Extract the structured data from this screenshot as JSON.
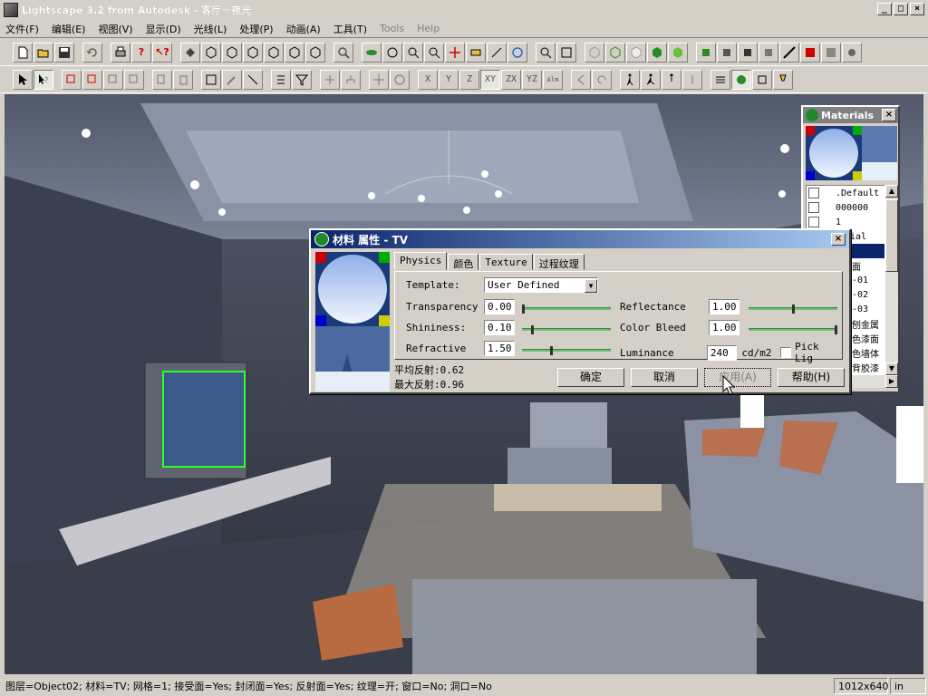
{
  "window": {
    "title": "Lightscape 3.2 from Autodesk - 客厅一夜光",
    "controls": {
      "minimize": "_",
      "maximize": "□",
      "close": "×"
    }
  },
  "menu": [
    {
      "label": "文件(F)",
      "dim": false
    },
    {
      "label": "编辑(E)",
      "dim": false
    },
    {
      "label": "视图(V)",
      "dim": false
    },
    {
      "label": "显示(D)",
      "dim": false
    },
    {
      "label": "光线(L)",
      "dim": false
    },
    {
      "label": "处理(P)",
      "dim": false
    },
    {
      "label": "动画(A)",
      "dim": false
    },
    {
      "label": "工具(T)",
      "dim": false
    },
    {
      "label": "Tools",
      "dim": true
    },
    {
      "label": "Help",
      "dim": true
    }
  ],
  "toolbar2_axes": [
    "X",
    "Y",
    "Z",
    "XY",
    "ZX",
    "YZ",
    "Alm"
  ],
  "dialog": {
    "title": "材料 属性 - TV",
    "close": "×",
    "tabs": [
      "Physics",
      "颜色",
      "Texture",
      "过程纹理"
    ],
    "active_tab": 0,
    "template_label": "Template:",
    "template_value": "User Defined",
    "fields": {
      "transparency": {
        "label": "Transparency",
        "value": "0.00",
        "slider": 0.0
      },
      "shininess": {
        "label": "Shininess:",
        "value": "0.10",
        "slider": 0.1
      },
      "refractive": {
        "label": "Refractive",
        "value": "1.50",
        "slider": 0.33
      },
      "reflectance": {
        "label": "Reflectance",
        "value": "1.00",
        "slider": 0.5
      },
      "color_bleed": {
        "label": "Color Bleed",
        "value": "1.00",
        "slider": 1.0
      },
      "luminance": {
        "label": "Luminance",
        "value": "240",
        "unit": "cd/m2"
      }
    },
    "pick_light_label": "Pick Lig",
    "avg_reflect": "平均反射:0.62",
    "max_reflect": "最大反射:0.96",
    "buttons": {
      "ok": "确定",
      "cancel": "取消",
      "apply": "应用(A)",
      "help": "帮助(H)"
    }
  },
  "materials": {
    "title": "Materials",
    "close": "×",
    "items": [
      ".Default",
      "000000",
      "1",
      "erial",
      "",
      "面",
      "-01",
      "-02",
      "-03",
      "刨金属",
      "色漆面",
      "色墙体",
      "背胶漆"
    ]
  },
  "status": {
    "text": "图层=Object02; 材料=TV; 网格=1; 接受面=Yes; 封闭面=Yes; 反射面=Yes; 纹理=开; 窗口=No; 洞口=No",
    "resolution": "1012x640",
    "units": "in"
  },
  "colors": {
    "dialog_title_start": "#0a246a",
    "dialog_title_end": "#a6caf0",
    "slider": "#6fbf73",
    "selection": "#0a246a"
  }
}
